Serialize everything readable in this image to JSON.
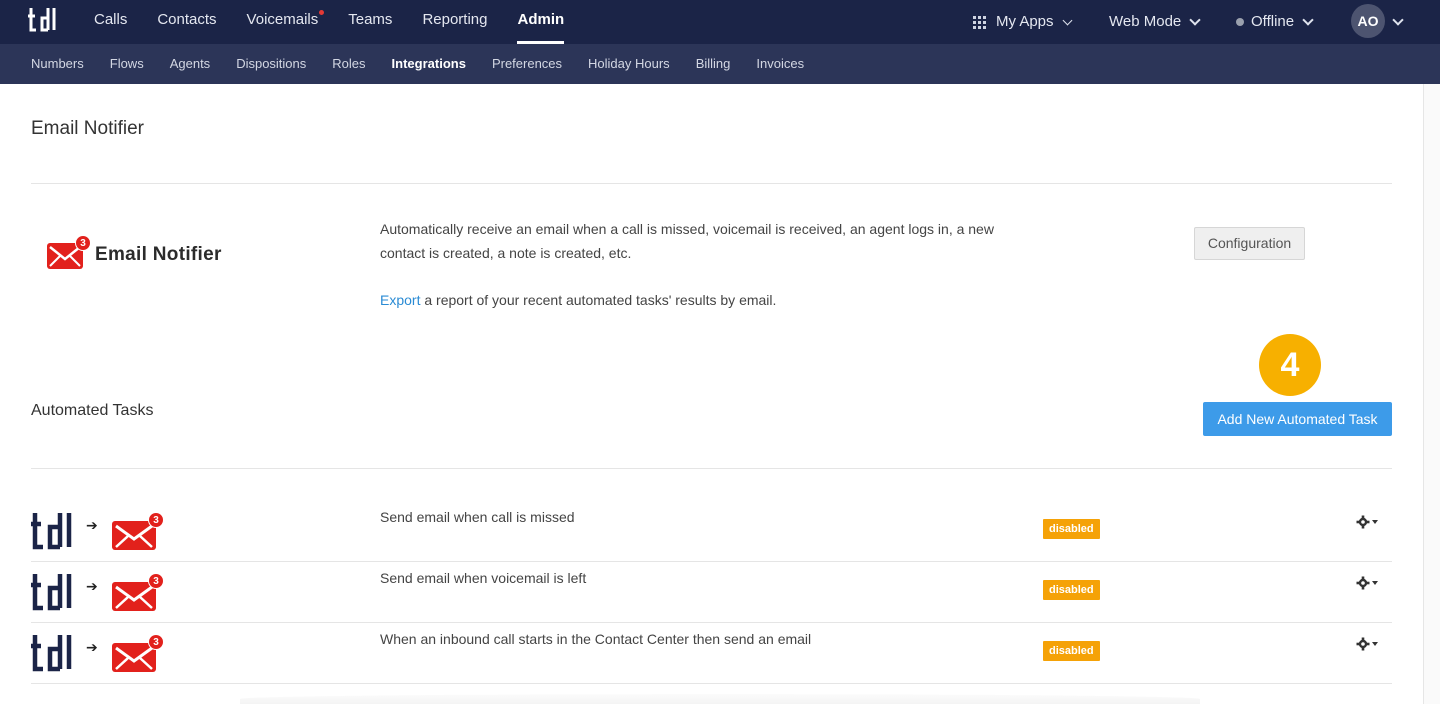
{
  "app": {
    "logo_icon": "tdl-logo"
  },
  "topnav": {
    "items": [
      {
        "label": "Calls"
      },
      {
        "label": "Contacts"
      },
      {
        "label": "Voicemails",
        "notification": true
      },
      {
        "label": "Teams"
      },
      {
        "label": "Reporting"
      },
      {
        "label": "Admin",
        "active": true
      }
    ],
    "my_apps": "My Apps",
    "web_mode": "Web Mode",
    "status": "Offline",
    "avatar_initials": "AO"
  },
  "subnav": {
    "items": [
      {
        "label": "Numbers"
      },
      {
        "label": "Flows"
      },
      {
        "label": "Agents"
      },
      {
        "label": "Dispositions"
      },
      {
        "label": "Roles"
      },
      {
        "label": "Integrations",
        "active": true
      },
      {
        "label": "Preferences"
      },
      {
        "label": "Holiday Hours"
      },
      {
        "label": "Billing"
      },
      {
        "label": "Invoices"
      }
    ]
  },
  "page": {
    "title": "Email Notifier",
    "brand_name": "Email Notifier",
    "mail_badge": "3",
    "description": "Automatically receive an email when a call is missed, voicemail is received, an agent logs in, a new contact is created, a note is created, etc.",
    "export_link": "Export",
    "export_text": " a report of your recent automated tasks' results by email.",
    "config_button": "Configuration",
    "step_number": "4",
    "section_title": "Automated Tasks",
    "add_button": "Add New Automated Task"
  },
  "tasks": [
    {
      "label": "Send email when call is missed",
      "status": "disabled",
      "badge": "3"
    },
    {
      "label": "Send email when voicemail is left",
      "status": "disabled",
      "badge": "3"
    },
    {
      "label": "When an inbound call starts in the Contact Center then send an email",
      "status": "disabled",
      "badge": "3"
    }
  ],
  "colors": {
    "topbar": "#1b2447",
    "subbar": "#2c3558",
    "accent_blue": "#3d9be9",
    "disabled_badge": "#f5a207",
    "mail_red": "#e2211c",
    "step_badge": "#f7b000"
  }
}
